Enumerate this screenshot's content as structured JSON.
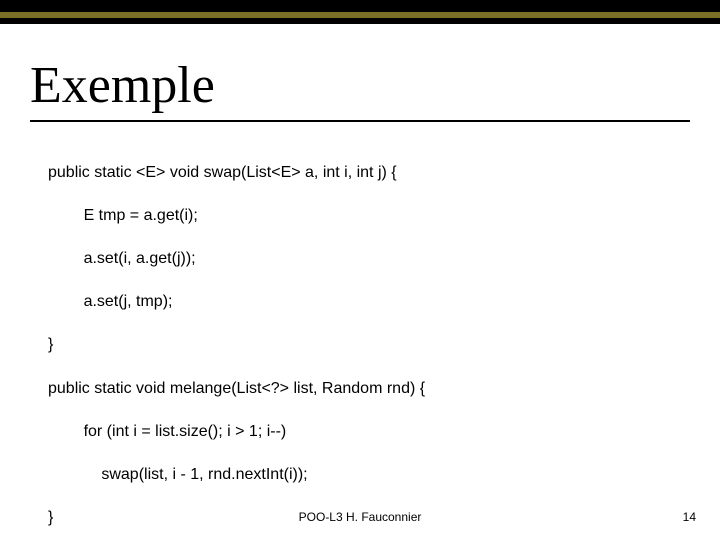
{
  "title": "Exemple",
  "code": {
    "l1": "public static <E> void swap(List<E> a, int i, int j) {",
    "l2": "        E tmp = a.get(i);",
    "l3": "        a.set(i, a.get(j));",
    "l4": "        a.set(j, tmp);",
    "l5": "}",
    "l6": "public static void melange(List<?> list, Random rnd) {",
    "l7": "        for (int i = list.size(); i > 1; i--)",
    "l8": "            swap(list, i - 1, rnd.nextInt(i));",
    "l9": "}"
  },
  "footer": "POO-L3 H. Fauconnier",
  "page_number": "14"
}
